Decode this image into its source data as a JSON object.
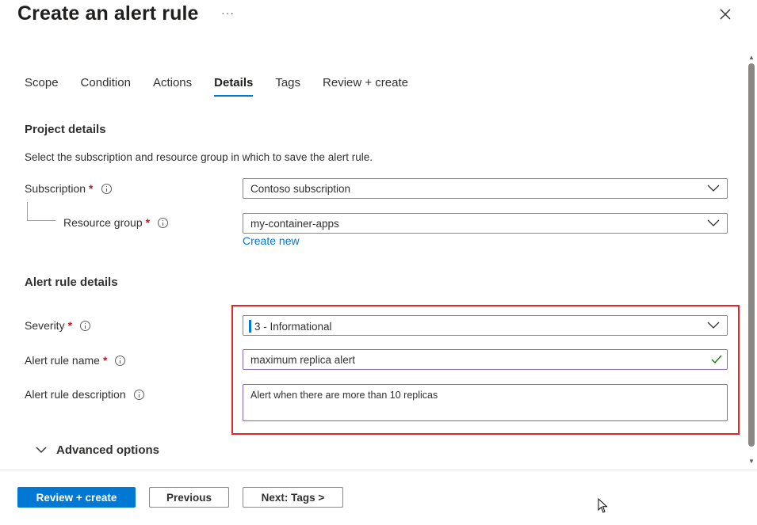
{
  "header": {
    "title": "Create an alert rule",
    "more": "···"
  },
  "tabs": [
    "Scope",
    "Condition",
    "Actions",
    "Details",
    "Tags",
    "Review + create"
  ],
  "active_tab": "Details",
  "project_details": {
    "heading": "Project details",
    "description": "Select the subscription and resource group in which to save the alert rule.",
    "subscription_label": "Subscription",
    "subscription_value": "Contoso subscription",
    "resource_group_label": "Resource group",
    "resource_group_value": "my-container-apps",
    "create_new": "Create new"
  },
  "alert_rule_details": {
    "heading": "Alert rule details",
    "severity_label": "Severity",
    "severity_value": "3 - Informational",
    "name_label": "Alert rule name",
    "name_value": "maximum replica alert",
    "description_label": "Alert rule description",
    "description_value": "Alert when there are more than 10 replicas"
  },
  "required_marker": "*",
  "advanced_options": "Advanced options",
  "footer": {
    "review_create": "Review + create",
    "previous": "Previous",
    "next": "Next: Tags >"
  },
  "colors": {
    "accent": "#0078d4",
    "highlight": "#e3242b",
    "valid_border": "#8764b8",
    "check": "#107c10"
  },
  "icons": [
    "close-icon",
    "info-icon",
    "chevron-down-icon",
    "checkmark-icon",
    "mouse-cursor-icon"
  ]
}
